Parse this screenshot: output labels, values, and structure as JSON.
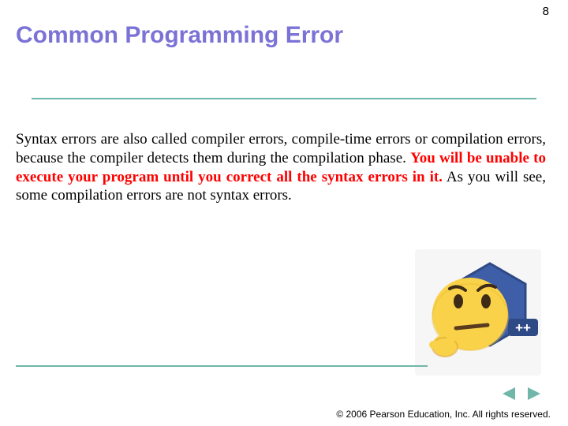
{
  "page_number": "8",
  "title": "Common Programming Error",
  "body": {
    "part1": "Syntax errors are also called compiler errors, compile-time errors or compilation errors, because the compiler detects them during the compilation phase. ",
    "emphasis": "You will be unable to execute your program until you correct all the syntax errors in it.",
    "part2": " As you will see, some compilation errors are not syntax errors."
  },
  "clipart": {
    "label": "cpp-thinking-emoji",
    "badge_text": "++",
    "colors": {
      "hex_fill": "#3f5ea8",
      "hex_stroke": "#2e4a86",
      "face_fill": "#f9d24a",
      "face_shadow": "#e8b92f",
      "mouth": "#5a3b1e",
      "eye": "#3d2a17",
      "brow": "#3d2a17",
      "hand": "#f9d24a",
      "hand_shadow": "#d99a2e"
    }
  },
  "nav": {
    "prev_color": "#6fb7a9",
    "next_color": "#6fb7a9"
  },
  "copyright": "© 2006 Pearson Education, Inc.  All rights reserved."
}
